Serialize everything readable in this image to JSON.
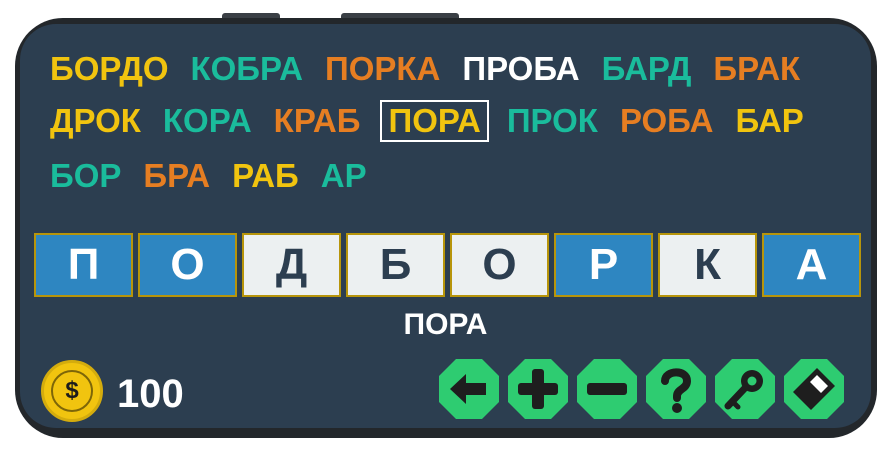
{
  "found_words": {
    "rows": [
      [
        {
          "text": "БОРДО",
          "color": "yellow"
        },
        {
          "text": "КОБРА",
          "color": "teal"
        },
        {
          "text": "ПОРКА",
          "color": "orange"
        },
        {
          "text": "ПРОБА",
          "color": "white"
        },
        {
          "text": "БАРД",
          "color": "teal"
        },
        {
          "text": "БРАК",
          "color": "orange"
        }
      ],
      [
        {
          "text": "ДРОК",
          "color": "yellow"
        },
        {
          "text": "КОРА",
          "color": "teal"
        },
        {
          "text": "КРАБ",
          "color": "orange"
        },
        {
          "text": "ПОРА",
          "color": "yellow",
          "selected": true
        },
        {
          "text": "ПРОК",
          "color": "teal"
        },
        {
          "text": "РОБА",
          "color": "orange"
        },
        {
          "text": "БАР",
          "color": "yellow"
        }
      ],
      [
        {
          "text": "БОР",
          "color": "teal"
        },
        {
          "text": "БРА",
          "color": "orange"
        },
        {
          "text": "РАБ",
          "color": "yellow"
        },
        {
          "text": "АР",
          "color": "teal"
        }
      ]
    ]
  },
  "tiles": [
    {
      "letter": "П",
      "state": "blue"
    },
    {
      "letter": "О",
      "state": "blue"
    },
    {
      "letter": "Д",
      "state": "light"
    },
    {
      "letter": "Б",
      "state": "light"
    },
    {
      "letter": "О",
      "state": "light"
    },
    {
      "letter": "Р",
      "state": "blue"
    },
    {
      "letter": "К",
      "state": "light"
    },
    {
      "letter": "А",
      "state": "blue"
    }
  ],
  "current_word": "ПОРА",
  "coins": {
    "symbol": "$",
    "count": "100"
  },
  "colors": {
    "screen_bg": "#2c3e50",
    "orange": "#e67e22",
    "yellow": "#f1c40f",
    "teal": "#1abc9c",
    "tile_blue": "#2e86c1",
    "tile_light": "#ecf0f1",
    "action_green": "#2ecc71"
  },
  "actions": [
    {
      "name": "back-button",
      "icon": "arrow-left-icon"
    },
    {
      "name": "add-button",
      "icon": "plus-icon"
    },
    {
      "name": "remove-button",
      "icon": "minus-icon"
    },
    {
      "name": "hint-button",
      "icon": "question-icon"
    },
    {
      "name": "key-button",
      "icon": "key-icon"
    },
    {
      "name": "erase-button",
      "icon": "eraser-icon"
    }
  ]
}
